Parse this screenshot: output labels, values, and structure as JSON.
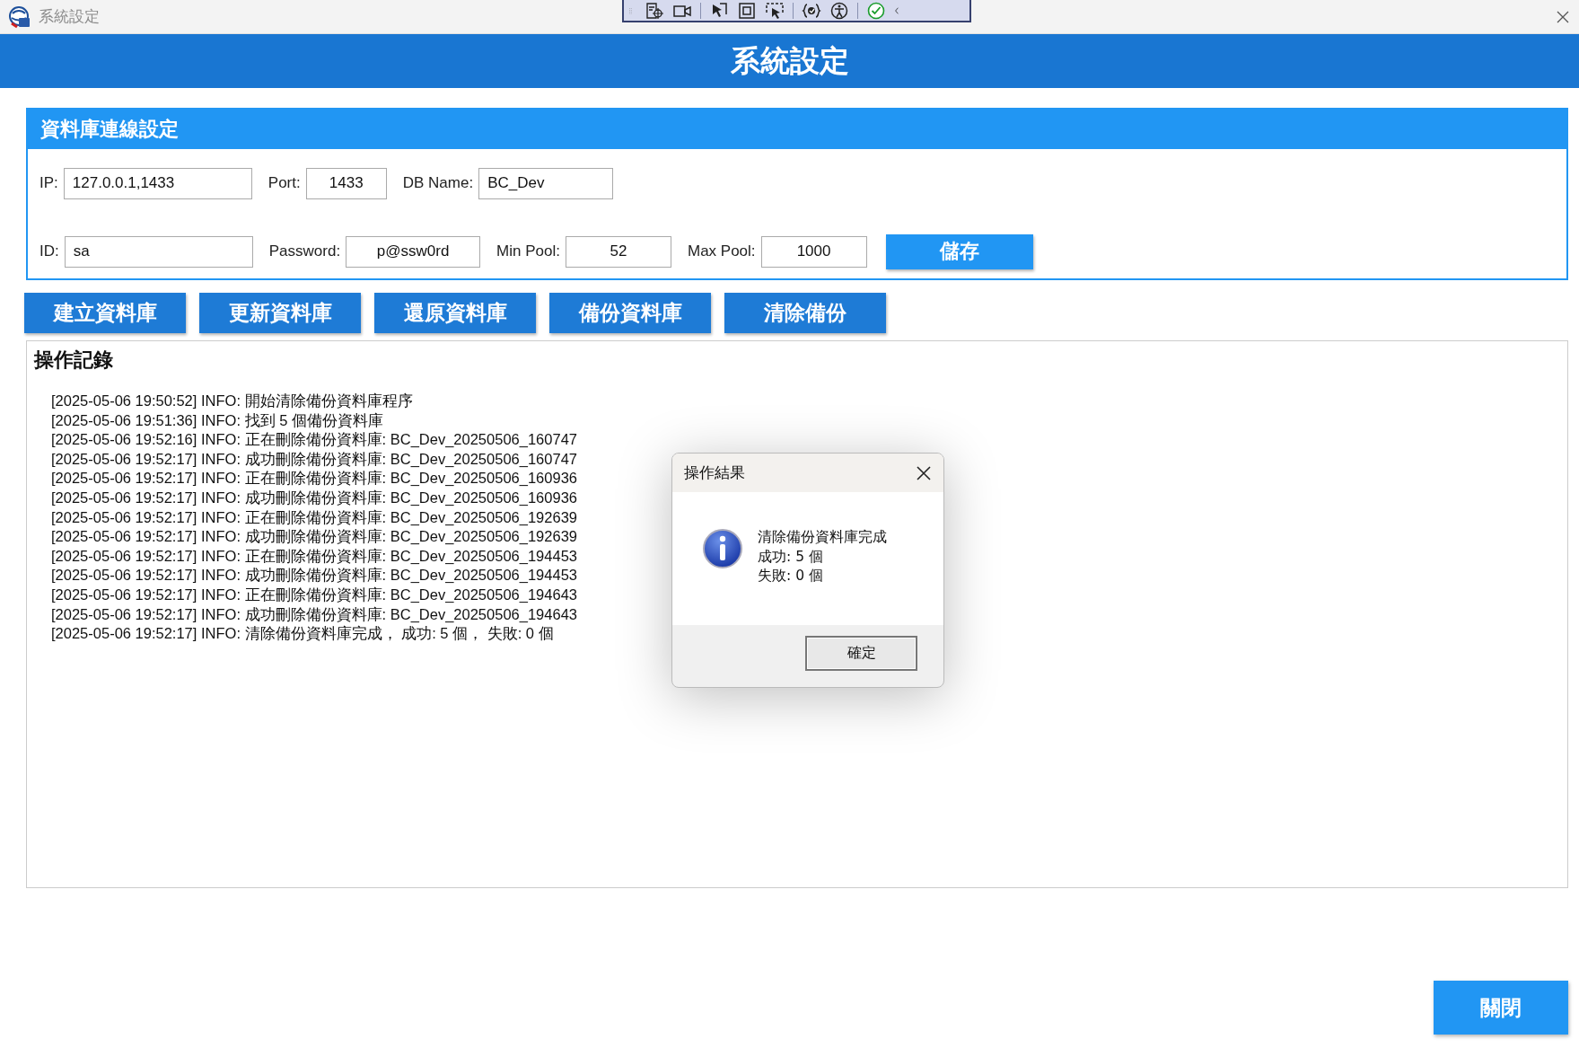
{
  "window": {
    "title": "系統設定"
  },
  "header": {
    "title": "系統設定"
  },
  "db_settings": {
    "title": "資料庫連線設定",
    "rows": [
      [
        {
          "label": "IP:",
          "value": "127.0.0.1,1433",
          "kind": "text"
        },
        {
          "label": "Port:",
          "value": "1433",
          "kind": "short"
        },
        {
          "label": "DB Name:",
          "value": "BC_Dev",
          "kind": "text"
        }
      ],
      [
        {
          "label": "ID:",
          "value": "sa",
          "kind": "text"
        },
        {
          "label": "Password:",
          "value": "p@ssw0rd",
          "kind": "short"
        },
        {
          "label": "Min Pool:",
          "value": "52",
          "kind": "short"
        },
        {
          "label": "Max Pool:",
          "value": "1000",
          "kind": "short"
        }
      ]
    ],
    "save_button": "儲存"
  },
  "actions": [
    "建立資料庫",
    "更新資料庫",
    "還原資料庫",
    "備份資料庫",
    "清除備份"
  ],
  "log": {
    "title": "操作記錄",
    "lines": [
      "[2025-05-06 19:50:52] INFO: 開始清除備份資料庫程序",
      "[2025-05-06 19:51:36] INFO: 找到 5 個備份資料庫",
      "[2025-05-06 19:52:16] INFO: 正在刪除備份資料庫: BC_Dev_20250506_160747",
      "[2025-05-06 19:52:17] INFO: 成功刪除備份資料庫: BC_Dev_20250506_160747",
      "[2025-05-06 19:52:17] INFO: 正在刪除備份資料庫: BC_Dev_20250506_160936",
      "[2025-05-06 19:52:17] INFO: 成功刪除備份資料庫: BC_Dev_20250506_160936",
      "[2025-05-06 19:52:17] INFO: 正在刪除備份資料庫: BC_Dev_20250506_192639",
      "[2025-05-06 19:52:17] INFO: 成功刪除備份資料庫: BC_Dev_20250506_192639",
      "[2025-05-06 19:52:17] INFO: 正在刪除備份資料庫: BC_Dev_20250506_194453",
      "[2025-05-06 19:52:17] INFO: 成功刪除備份資料庫: BC_Dev_20250506_194453",
      "[2025-05-06 19:52:17] INFO: 正在刪除備份資料庫: BC_Dev_20250506_194643",
      "[2025-05-06 19:52:17] INFO: 成功刪除備份資料庫: BC_Dev_20250506_194643",
      "[2025-05-06 19:52:17] INFO: 清除備份資料庫完成， 成功: 5 個， 失敗: 0 個"
    ]
  },
  "dialog": {
    "title": "操作結果",
    "message_lines": [
      "清除備份資料庫完成",
      "成功: 5 個",
      "失敗: 0 個"
    ],
    "ok_button": "確定"
  },
  "close_button": "關閉"
}
